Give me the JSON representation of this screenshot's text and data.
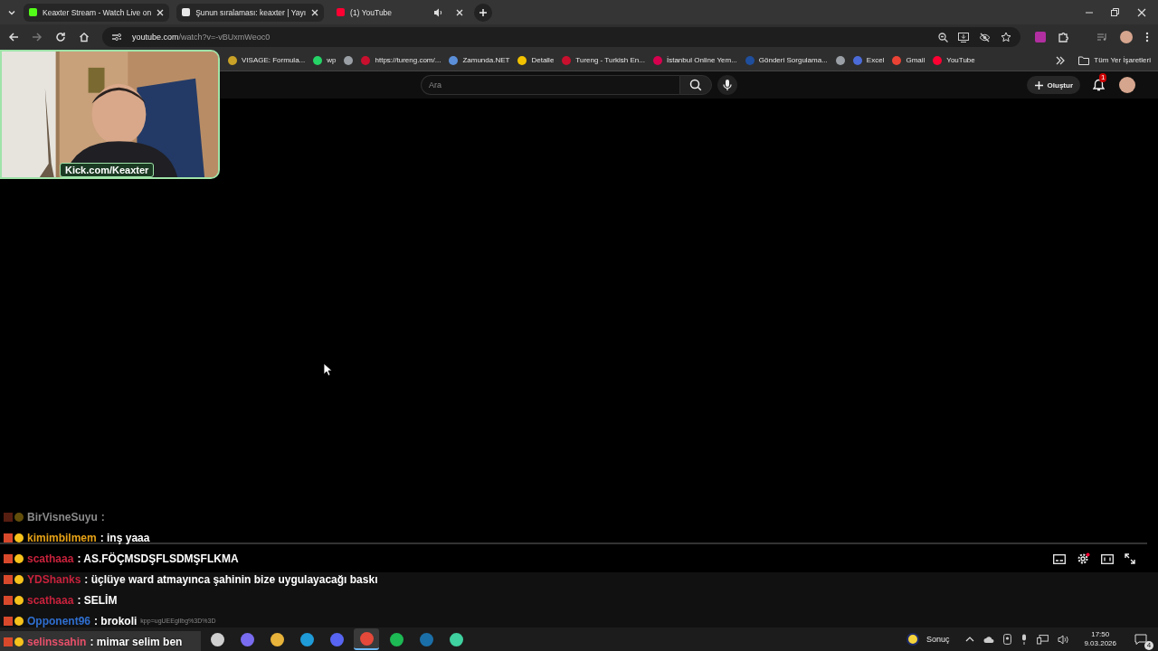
{
  "tabs": [
    {
      "label": "Keaxter Stream - Watch Live on",
      "selected": false,
      "color": "#53fc18",
      "audio": false
    },
    {
      "label": "Şunun sıralaması: keaxter | Yayı",
      "selected": false,
      "color": "#e8e8e8",
      "audio": false
    },
    {
      "label": "(1) YouTube",
      "selected": true,
      "color": "#ff0033",
      "audio": true
    }
  ],
  "address_bar": {
    "domain": "youtube.com",
    "path": "/watch?v=-vBUxmWeoc0"
  },
  "bookmarks": [
    {
      "label": "VISAGE: Formula...",
      "color": "#c9a227"
    },
    {
      "label": "wp",
      "color": "#25d366"
    },
    {
      "color": "#9aa0a6"
    },
    {
      "label": "https://tureng.com/...",
      "color": "#c8102e"
    },
    {
      "label": "Zamunda.NET",
      "color": "#5b8fd9"
    },
    {
      "label": "Detalle",
      "color": "#f2c200"
    },
    {
      "label": "Tureng - Turkish En...",
      "color": "#c8102e"
    },
    {
      "label": "İstanbul Online Yem...",
      "color": "#d6004f"
    },
    {
      "label": "Gönderi Sorgulama...",
      "color": "#1f4e9c"
    },
    {
      "color": "#9aa0a6"
    },
    {
      "label": "Excel",
      "color": "#4b6bd8"
    },
    {
      "label": "Gmail",
      "color": "#ea4335"
    },
    {
      "label": "YouTube",
      "color": "#ff0033"
    }
  ],
  "all_bookmarks": "Tüm Yer İşaretleri",
  "youtube_header": {
    "search_placeholder": "Ara",
    "create_label": "Oluştur",
    "notification_count": "1"
  },
  "webcam": {
    "kind": "picture",
    "caption": "Kick.com/Keaxter"
  },
  "chat": [
    {
      "user": "BirVisneSuyu",
      "separator": ":",
      "color": "#8a8a8a",
      "faded": true,
      "highlighted": false
    },
    {
      "user": "kimimbilmem",
      "separator": ":",
      "text": "inş yaaa",
      "color": "#e8a317",
      "faded": false,
      "highlighted": false
    },
    {
      "user": "scathaaa",
      "separator": ":",
      "text": "AS.FÖÇMSDŞFLSDMŞFLKMA",
      "color": "#c8223c",
      "faded": false,
      "highlighted": false
    },
    {
      "user": "YDShanks",
      "separator": ":",
      "text": "üçlüye ward atmayınca şahinin bize uygulayacağı baskı",
      "color": "#c8223c",
      "faded": false,
      "highlighted": false
    },
    {
      "user": "scathaaa",
      "separator": ":",
      "text": "SELİM",
      "color": "#c8223c",
      "faded": false,
      "highlighted": false
    },
    {
      "user": "Opponent96",
      "separator": ":",
      "text": "brokoli",
      "color": "#2f6fd0",
      "faded": false,
      "highlighted": false,
      "trailing": "kpp=ugUEEgIlbg%3D%3D"
    },
    {
      "user": "selinssahin",
      "separator": ":",
      "text": "mimar selim ben",
      "color": "#e8506a",
      "faded": false,
      "highlighted": true
    }
  ],
  "taskbar": {
    "apps": [
      {
        "kind": "taskview",
        "active": false
      },
      {
        "kind": "copilot",
        "active": false
      },
      {
        "kind": "explorer",
        "active": false
      },
      {
        "kind": "edge",
        "active": false
      },
      {
        "kind": "discord",
        "active": false
      },
      {
        "kind": "chrome",
        "active": true
      },
      {
        "kind": "spotify",
        "active": false
      },
      {
        "kind": "steam",
        "active": false
      },
      {
        "kind": "green",
        "active": false
      }
    ],
    "weather_label": "Sonuç",
    "time": "17:50",
    "date": "9.03.2026",
    "notification_count": "4"
  }
}
